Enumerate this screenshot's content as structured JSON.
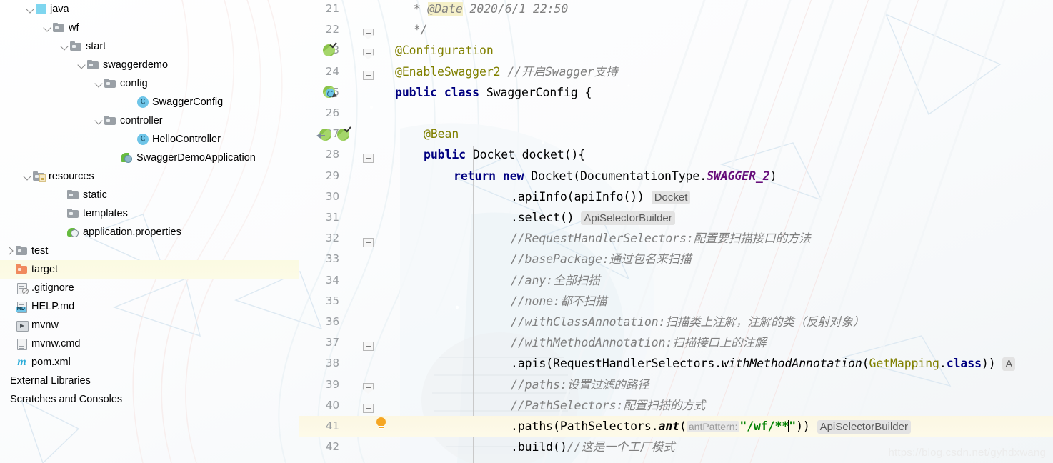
{
  "sidebar": {
    "name": "project-tree",
    "items": [
      {
        "label": "java",
        "indent": 36,
        "twisty": "down",
        "icon": "src-root",
        "selected": false
      },
      {
        "label": "wf",
        "indent": 60,
        "twisty": "down",
        "icon": "folder",
        "selected": false
      },
      {
        "label": "start",
        "indent": 84,
        "twisty": "down",
        "icon": "folder",
        "selected": false
      },
      {
        "label": "swaggerdemo",
        "indent": 108,
        "twisty": "down",
        "icon": "folder",
        "selected": false
      },
      {
        "label": "config",
        "indent": 132,
        "twisty": "down",
        "icon": "folder",
        "selected": false
      },
      {
        "label": "SwaggerConfig",
        "indent": 178,
        "twisty": "none",
        "icon": "class",
        "selected": false
      },
      {
        "label": "controller",
        "indent": 132,
        "twisty": "down",
        "icon": "folder",
        "selected": false
      },
      {
        "label": "HelloController",
        "indent": 178,
        "twisty": "none",
        "icon": "class",
        "selected": false
      },
      {
        "label": "SwaggerDemoApplication",
        "indent": 155,
        "twisty": "none",
        "icon": "spring-app",
        "selected": false
      },
      {
        "label": "resources",
        "indent": 32,
        "twisty": "down",
        "icon": "res-folder",
        "selected": false
      },
      {
        "label": "static",
        "indent": 80,
        "twisty": "none",
        "icon": "folder",
        "selected": false
      },
      {
        "label": "templates",
        "indent": 80,
        "twisty": "none",
        "icon": "folder",
        "selected": false
      },
      {
        "label": "application.properties",
        "indent": 80,
        "twisty": "none",
        "icon": "properties",
        "selected": false
      },
      {
        "label": "test",
        "indent": 8,
        "twisty": "right",
        "icon": "folder",
        "selected": false
      },
      {
        "label": "target",
        "indent": 8,
        "twisty": "none",
        "icon": "folder-orange",
        "selected": true
      },
      {
        "label": ".gitignore",
        "indent": 8,
        "twisty": "none",
        "icon": "gitignore",
        "selected": false
      },
      {
        "label": "HELP.md",
        "indent": 8,
        "twisty": "none",
        "icon": "markdown",
        "selected": false
      },
      {
        "label": "mvnw",
        "indent": 8,
        "twisty": "none",
        "icon": "shell",
        "selected": false
      },
      {
        "label": "mvnw.cmd",
        "indent": 8,
        "twisty": "none",
        "icon": "doc",
        "selected": false
      },
      {
        "label": "pom.xml",
        "indent": 8,
        "twisty": "none",
        "icon": "maven",
        "selected": false
      },
      {
        "label": "External Libraries",
        "indent": 0,
        "twisty": "none",
        "icon": "none",
        "selected": false
      },
      {
        "label": "Scratches and Consoles",
        "indent": 0,
        "twisty": "none",
        "icon": "none",
        "selected": false
      }
    ]
  },
  "editor": {
    "name": "code-editor",
    "file": "SwaggerConfig.java",
    "first_line_number": 21,
    "highlighted_line": 41,
    "lines": [
      {
        "n": 21,
        "text": " * @Date 2020/6/1 22:50"
      },
      {
        "n": 22,
        "text": " */"
      },
      {
        "n": 23,
        "text": "@Configuration"
      },
      {
        "n": 24,
        "text": "@EnableSwagger2 //开启Swagger支持"
      },
      {
        "n": 25,
        "text": "public class SwaggerConfig {"
      },
      {
        "n": 26,
        "text": ""
      },
      {
        "n": 27,
        "text": "    @Bean"
      },
      {
        "n": 28,
        "text": "    public Docket docket(){"
      },
      {
        "n": 29,
        "text": "        return new Docket(DocumentationType.SWAGGER_2)"
      },
      {
        "n": 30,
        "text": "                .apiInfo(apiInfo()) Docket"
      },
      {
        "n": 31,
        "text": "                .select() ApiSelectorBuilder"
      },
      {
        "n": 32,
        "text": "                //RequestHandlerSelectors:配置要扫描接口的方法"
      },
      {
        "n": 33,
        "text": "                //basePackage:通过包名来扫描"
      },
      {
        "n": 34,
        "text": "                //any:全部扫描"
      },
      {
        "n": 35,
        "text": "                //none:都不扫描"
      },
      {
        "n": 36,
        "text": "                //withClassAnnotation:扫描类上注解，注解的类（反射对象）"
      },
      {
        "n": 37,
        "text": "                //withMethodAnnotation:扫描接口上的注解"
      },
      {
        "n": 38,
        "text": "                .apis(RequestHandlerSelectors.withMethodAnnotation(GetMapping.class)) A"
      },
      {
        "n": 39,
        "text": "                //paths:设置过滤的路径"
      },
      {
        "n": 40,
        "text": "                //PathSelectors:配置扫描的方式"
      },
      {
        "n": 41,
        "text": "                .paths(PathSelectors.ant( antPattern: \"/wf/**\")) ApiSelectorBuilder"
      },
      {
        "n": 42,
        "text": "                .build()//这是一个工厂模式"
      }
    ],
    "tokens": {
      "l21_star": " * ",
      "l21_date": "@Date",
      "l21_rest": " 2020/6/1 22:50",
      "l22": " */",
      "l23": "@Configuration",
      "l24_anno": "@EnableSwagger2",
      "l24_cmt": " //开启Swagger支持",
      "l25_kw1": "public class",
      "l25_name": " SwaggerConfig {",
      "l27": "@Bean",
      "l28_kw": "public",
      "l28_rest": " Docket docket(){",
      "l29_kw1": "return",
      "l29_kw2": "new",
      "l29_a": " Docket(DocumentationType.",
      "l29_static": "SWAGGER_2",
      "l29_b": ")",
      "l30_code": ".apiInfo(apiInfo())",
      "l30_hint": "Docket",
      "l31_code": ".select()",
      "l31_hint": "ApiSelectorBuilder",
      "l32": "//RequestHandlerSelectors:配置要扫描接口的方法",
      "l33": "//basePackage:通过包名来扫描",
      "l34": "//any:全部扫描",
      "l35": "//none:都不扫描",
      "l36": "//withClassAnnotation:扫描类上注解，注解的类（反射对象）",
      "l37": "//withMethodAnnotation:扫描接口上的注解",
      "l38_a": ".apis(RequestHandlerSelectors.",
      "l38_m": "withMethodAnnotation",
      "l38_b": "(",
      "l38_c": "GetMapping",
      "l38_d": ".",
      "l38_e": "class",
      "l38_f": "))",
      "l38_cut": "A",
      "l39": "//paths:设置过滤的路径",
      "l40": "//PathSelectors:配置扫描的方式",
      "l41_a": ".paths(PathSelectors.",
      "l41_m": "ant",
      "l41_b": "(",
      "l41_phint": "antPattern:",
      "l41_str": "\"/wf/**\"",
      "l41_c": "))",
      "l41_hint": "ApiSelectorBuilder",
      "l42_a": ".build()",
      "l42_cmt": "//这是一个工厂模式"
    }
  },
  "watermark": {
    "text": "https://blog.csdn.net/gyhdxwang"
  },
  "colors": {
    "keyword": "#000080",
    "annotation": "#808000",
    "comment": "#808080",
    "string": "#008000",
    "static_field": "#660e7a",
    "selected_row": "#fbfae2",
    "highlight_line": "#fcf7e3",
    "gutter_text": "#999da1",
    "bean_icon": "#8bc34a",
    "bulb": "#f5a623",
    "folder": "#9aa0a6",
    "folder_target": "#f08a5d",
    "class_badge": "#6fc5e8"
  }
}
